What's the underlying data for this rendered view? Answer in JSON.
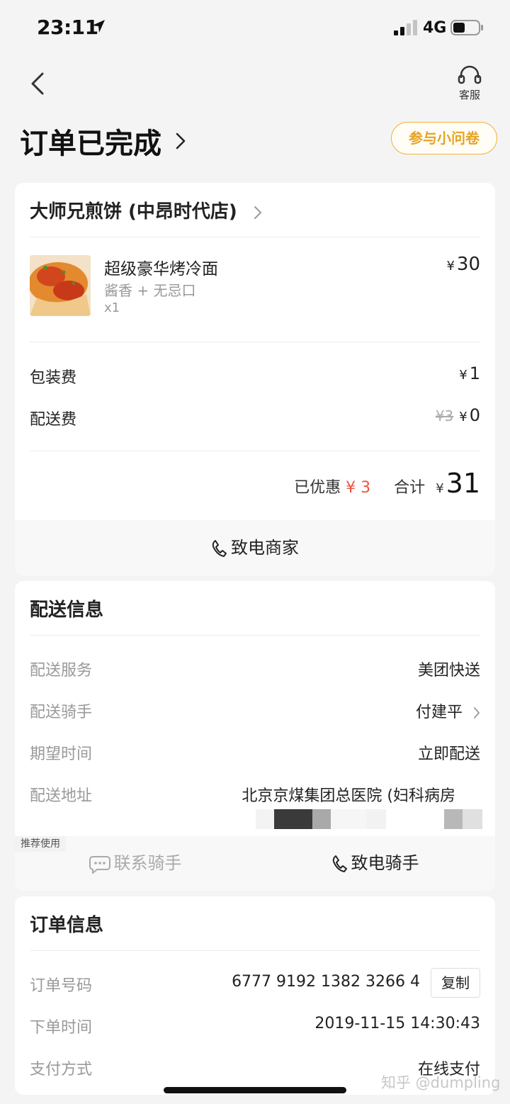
{
  "status_bar": {
    "time": "23:11",
    "network": "4G"
  },
  "nav": {
    "service_label": "客服"
  },
  "header": {
    "title": "订单已完成",
    "survey_label": "参与小问卷"
  },
  "shop": {
    "name": "大师兄煎饼 (中昂时代店)"
  },
  "item": {
    "name": "超级豪华烤冷面",
    "spec": "酱香 + 无忌口",
    "qty": "x1",
    "currency": "¥",
    "price": "30"
  },
  "fees": [
    {
      "label": "包装费",
      "currency": "¥",
      "value": "1"
    },
    {
      "label": "配送费",
      "original": "¥3",
      "currency": "¥",
      "value": "0"
    }
  ],
  "totals": {
    "discount_label": "已优惠",
    "discount_value": "¥ 3",
    "total_label": "合计",
    "currency": "¥",
    "total": "31"
  },
  "call_merchant_label": "致电商家",
  "delivery": {
    "title": "配送信息",
    "rows": [
      {
        "label": "配送服务",
        "value": "美团快送"
      },
      {
        "label": "配送骑手",
        "value": "付建平"
      },
      {
        "label": "期望时间",
        "value": "立即配送"
      },
      {
        "label": "配送地址",
        "value": "北京京煤集团总医院 (妇科病房"
      }
    ],
    "recommend_badge": "推荐使用",
    "contact_rider_label": "联系骑手",
    "call_rider_label": "致电骑手"
  },
  "order": {
    "title": "订单信息",
    "rows": [
      {
        "label": "订单号码",
        "value": "6777 9192 1382 3266 4"
      },
      {
        "label": "下单时间",
        "value": "2019-11-15 14:30:43"
      },
      {
        "label": "支付方式",
        "value": "在线支付"
      }
    ],
    "copy_label": "复制"
  },
  "watermark": "知乎 @dumpling",
  "colors": {
    "accent": "#f2b33d",
    "discount": "#f0533d",
    "background": "#f4f4f4"
  }
}
